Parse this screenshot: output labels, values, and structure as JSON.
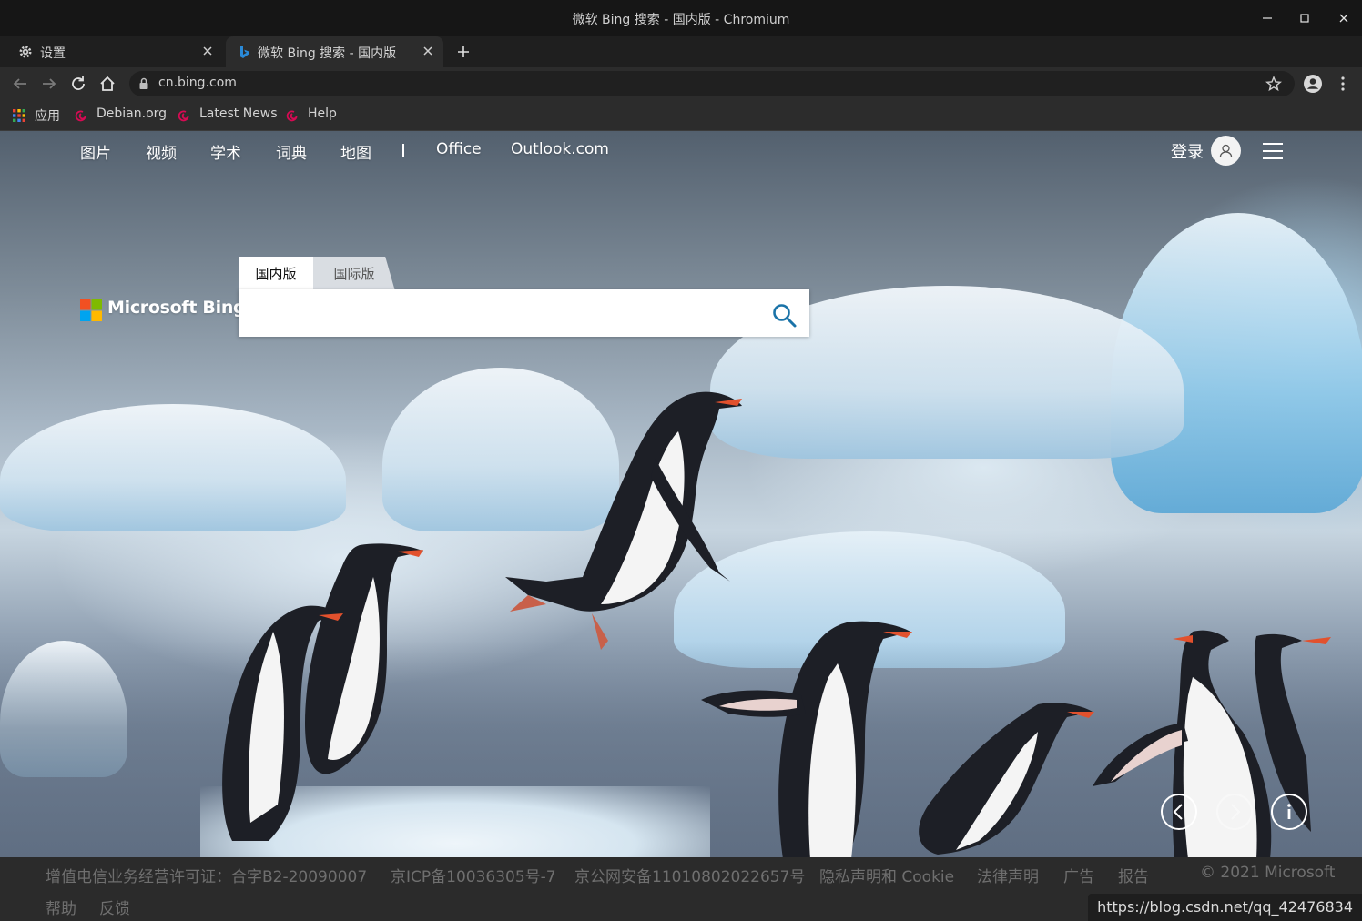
{
  "window": {
    "title": "微软 Bing 搜索 - 国内版 - Chromium"
  },
  "tabs": [
    {
      "label": "设置",
      "icon": "gear-icon"
    },
    {
      "label": "微软 Bing 搜索 - 国内版",
      "icon": "bing-icon",
      "active": true
    }
  ],
  "omnibox": {
    "url": "cn.bing.com"
  },
  "bookmarks": {
    "apps": "应用",
    "items": [
      "Debian.org",
      "Latest News",
      "Help"
    ]
  },
  "bing": {
    "nav": [
      "图片",
      "视频",
      "学术",
      "词典",
      "地图",
      "Office",
      "Outlook.com"
    ],
    "signin": "登录",
    "logo_text": "Microsoft Bing",
    "scope_tabs": [
      "国内版",
      "国际版"
    ],
    "search_value": ""
  },
  "footer": {
    "line1": [
      "增值电信业务经营许可证：合字B2-20090007",
      "京ICP备10036305号-7",
      "京公网安备11010802022657号",
      "隐私声明和 Cookie",
      "法律声明",
      "广告",
      "报告"
    ],
    "copyright": "© 2021 Microsoft",
    "line2": [
      "帮助",
      "反馈"
    ]
  },
  "status_bar_url": "https://blog.csdn.net/qq_42476834",
  "colors": {
    "accent_blue": "#1a73a8",
    "debian_red": "#d70a53"
  }
}
